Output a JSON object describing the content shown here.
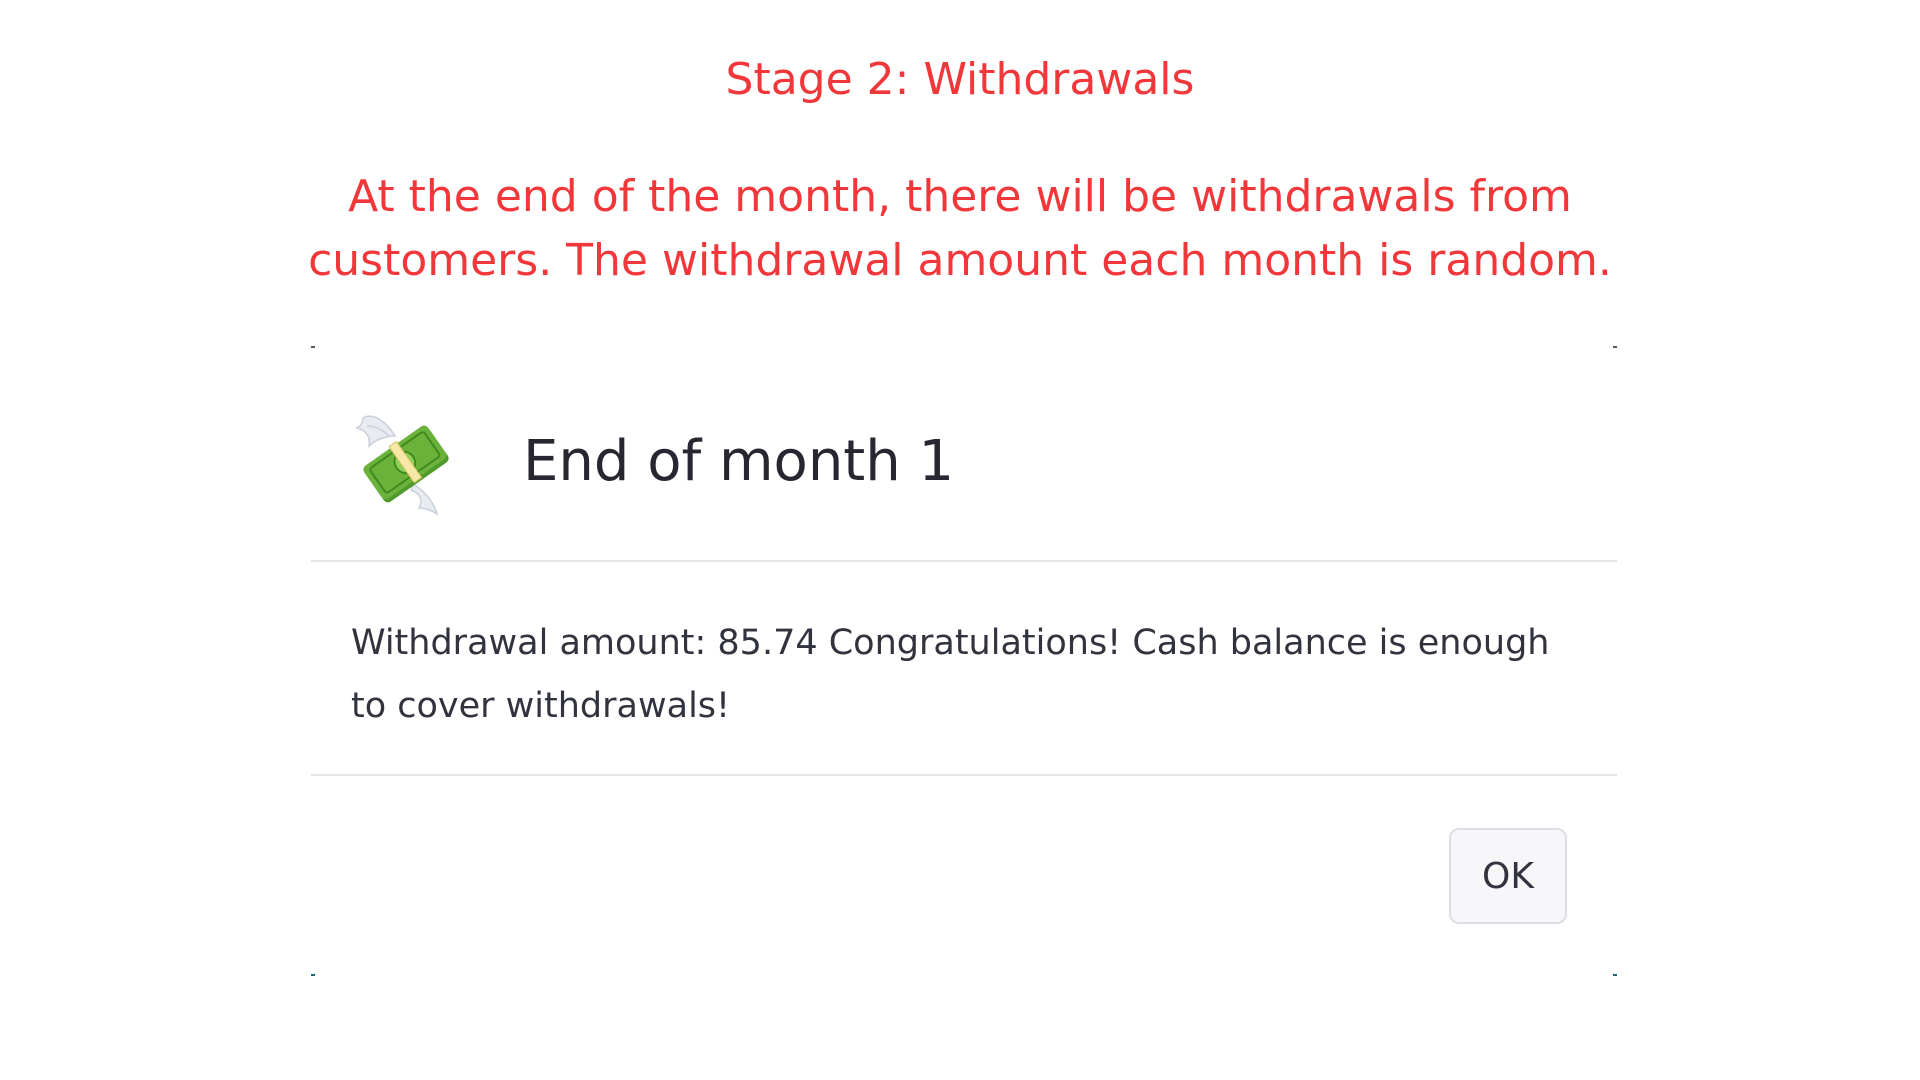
{
  "tutorial": {
    "stage_title": "Stage 2: Withdrawals",
    "stage_description": "At the end of the month, there will be withdrawals from customers. The withdrawal amount each month is random."
  },
  "dialog": {
    "icon": "money-with-wings-icon",
    "title": "End of month 1",
    "message": "Withdrawal amount: 85.74 Congratulations! Cash balance is enough to cover withdrawals!",
    "ok_label": "OK"
  },
  "colors": {
    "instruction_text": "#f2373a",
    "money_green": "#6ab23a",
    "title_text": "#262730",
    "body_text": "#31333f",
    "divider": "#e6e6e6",
    "button_bg": "#f7f7f9",
    "button_border": "#dcdde2"
  }
}
